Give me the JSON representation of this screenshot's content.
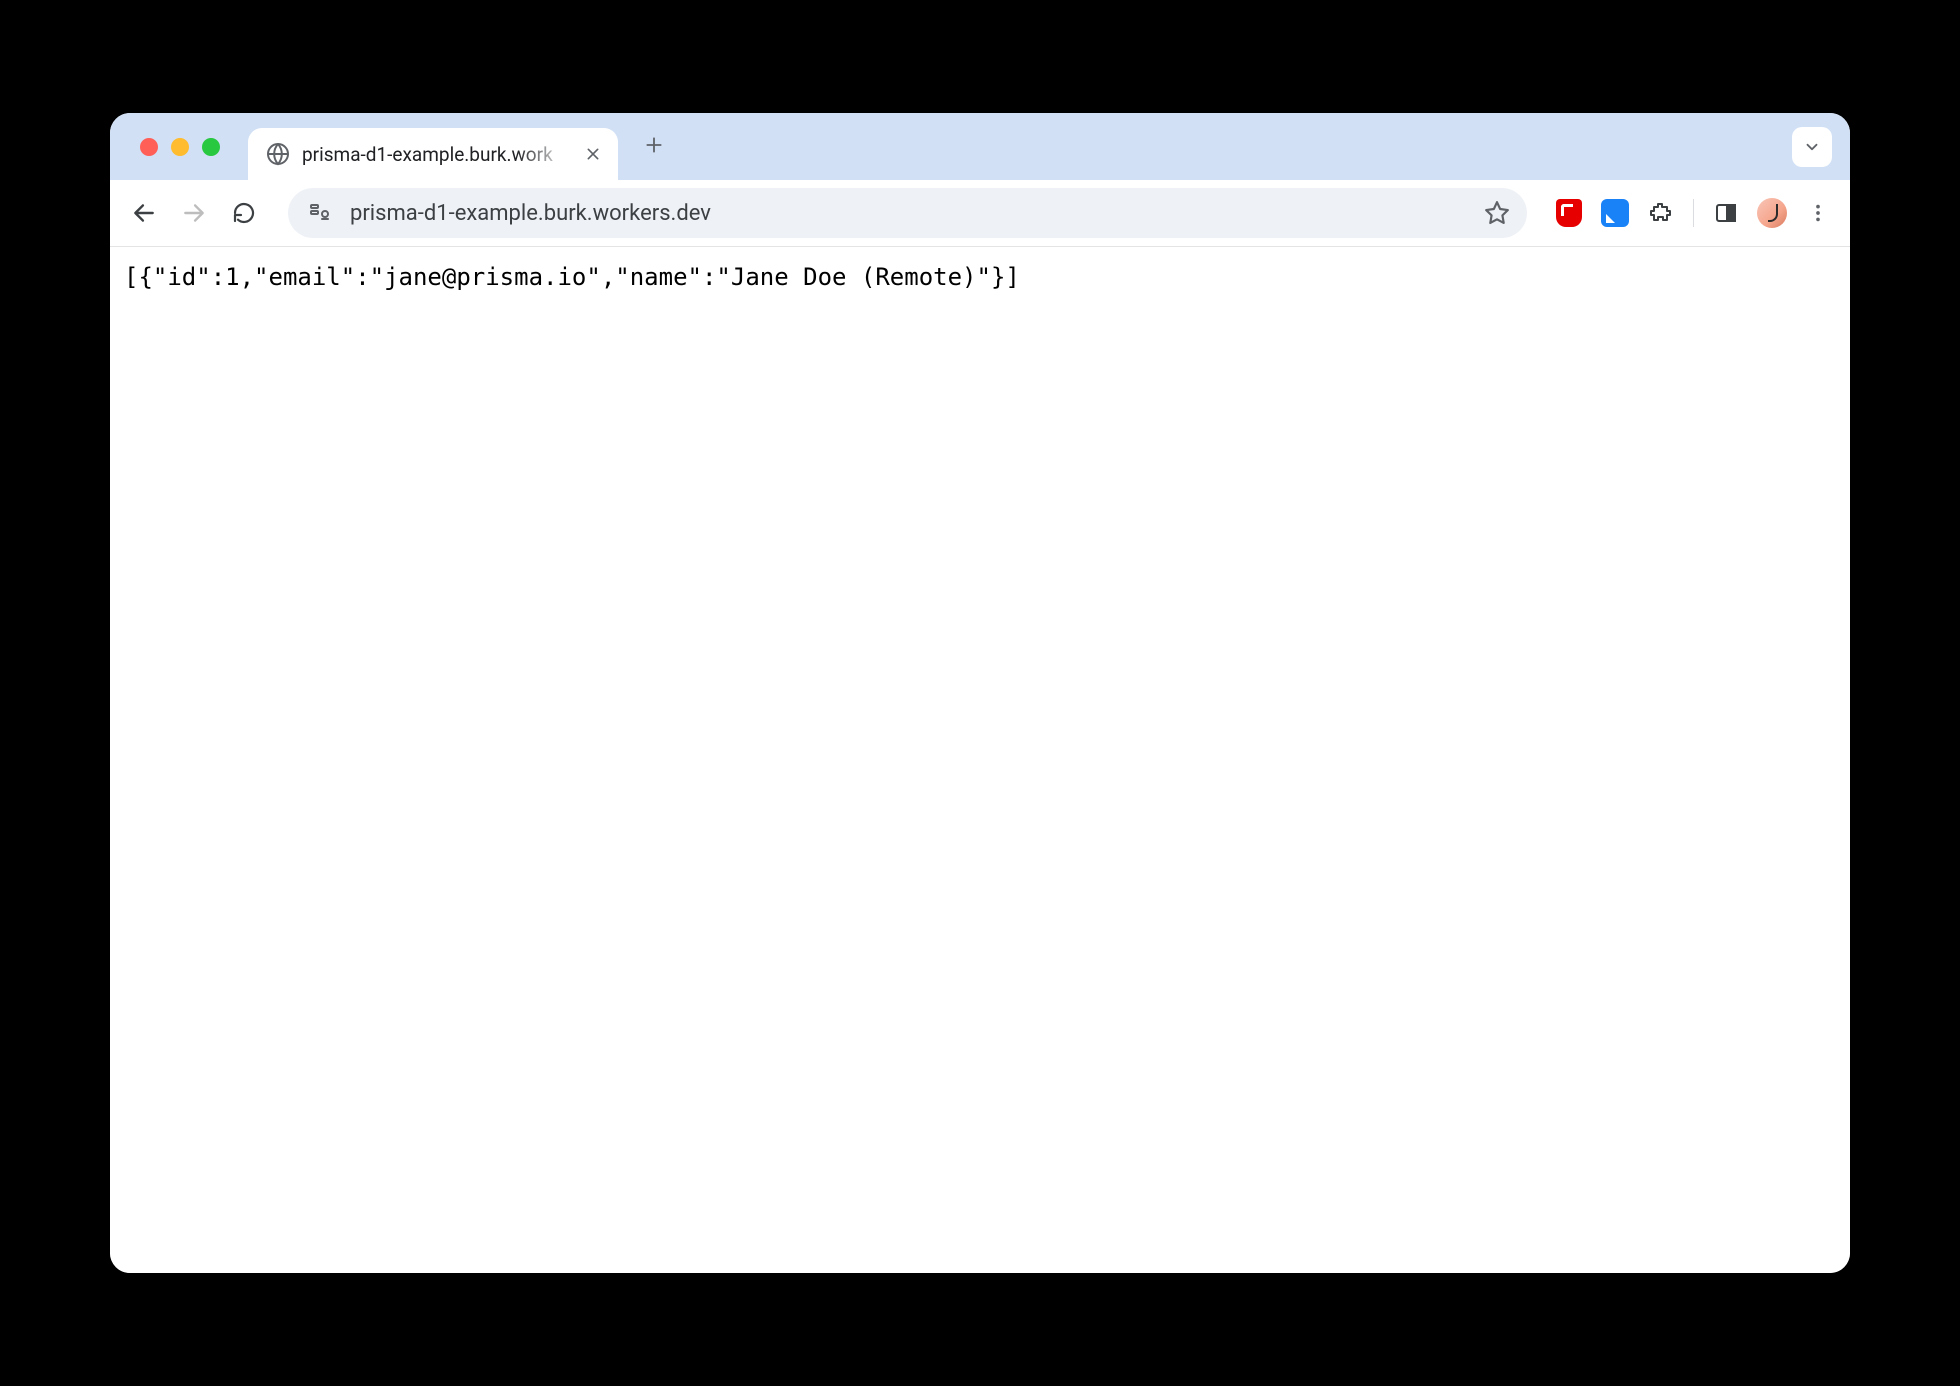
{
  "browser": {
    "tab": {
      "title": "prisma-d1-example.burk.work"
    },
    "address_bar": {
      "url": "prisma-d1-example.burk.workers.dev"
    }
  },
  "page": {
    "response_text": "[{\"id\":1,\"email\":\"jane@prisma.io\",\"name\":\"Jane Doe (Remote)\"}]"
  }
}
